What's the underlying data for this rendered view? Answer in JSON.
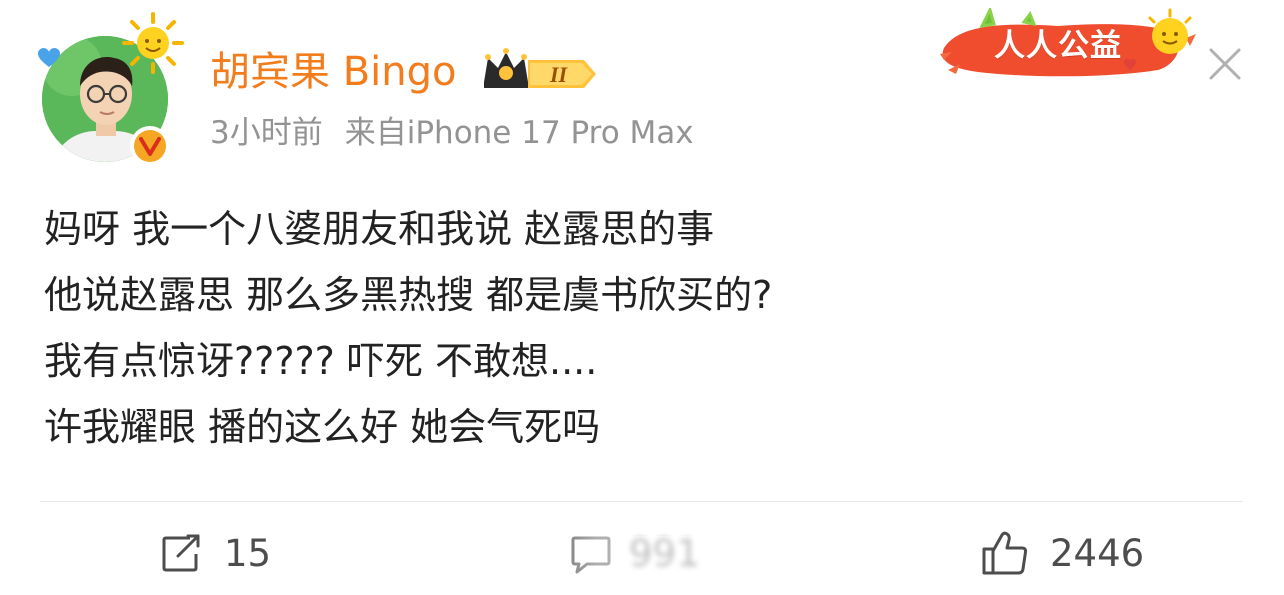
{
  "header": {
    "username": "胡宾果 Bingo",
    "time": "3小时前",
    "source": "来自iPhone 17 Pro Max",
    "member_level": "II",
    "charity_label": "人人公益"
  },
  "post": {
    "lines": [
      "妈呀 我一个八婆朋友和我说 赵露思的事",
      "他说赵露思 那么多黑热搜 都是虞书欣买的?",
      "我有点惊讶?????  吓死 不敢想....",
      "许我耀眼 播的这么好 她会气死吗"
    ]
  },
  "actions": {
    "share_count": "15",
    "comment_count": "991",
    "like_count": "2446"
  },
  "colors": {
    "username": "#f37c1c",
    "meta": "#939393",
    "text": "#222222",
    "action_text": "#4d4d4d",
    "charity_red": "#e8422c",
    "verified": "#f5a623"
  },
  "icons": {
    "share": "share-icon",
    "comment": "comment-icon",
    "like": "like-icon",
    "close": "close-icon",
    "verified": "verified-icon",
    "member": "crown-icon",
    "sun": "sun-icon"
  }
}
